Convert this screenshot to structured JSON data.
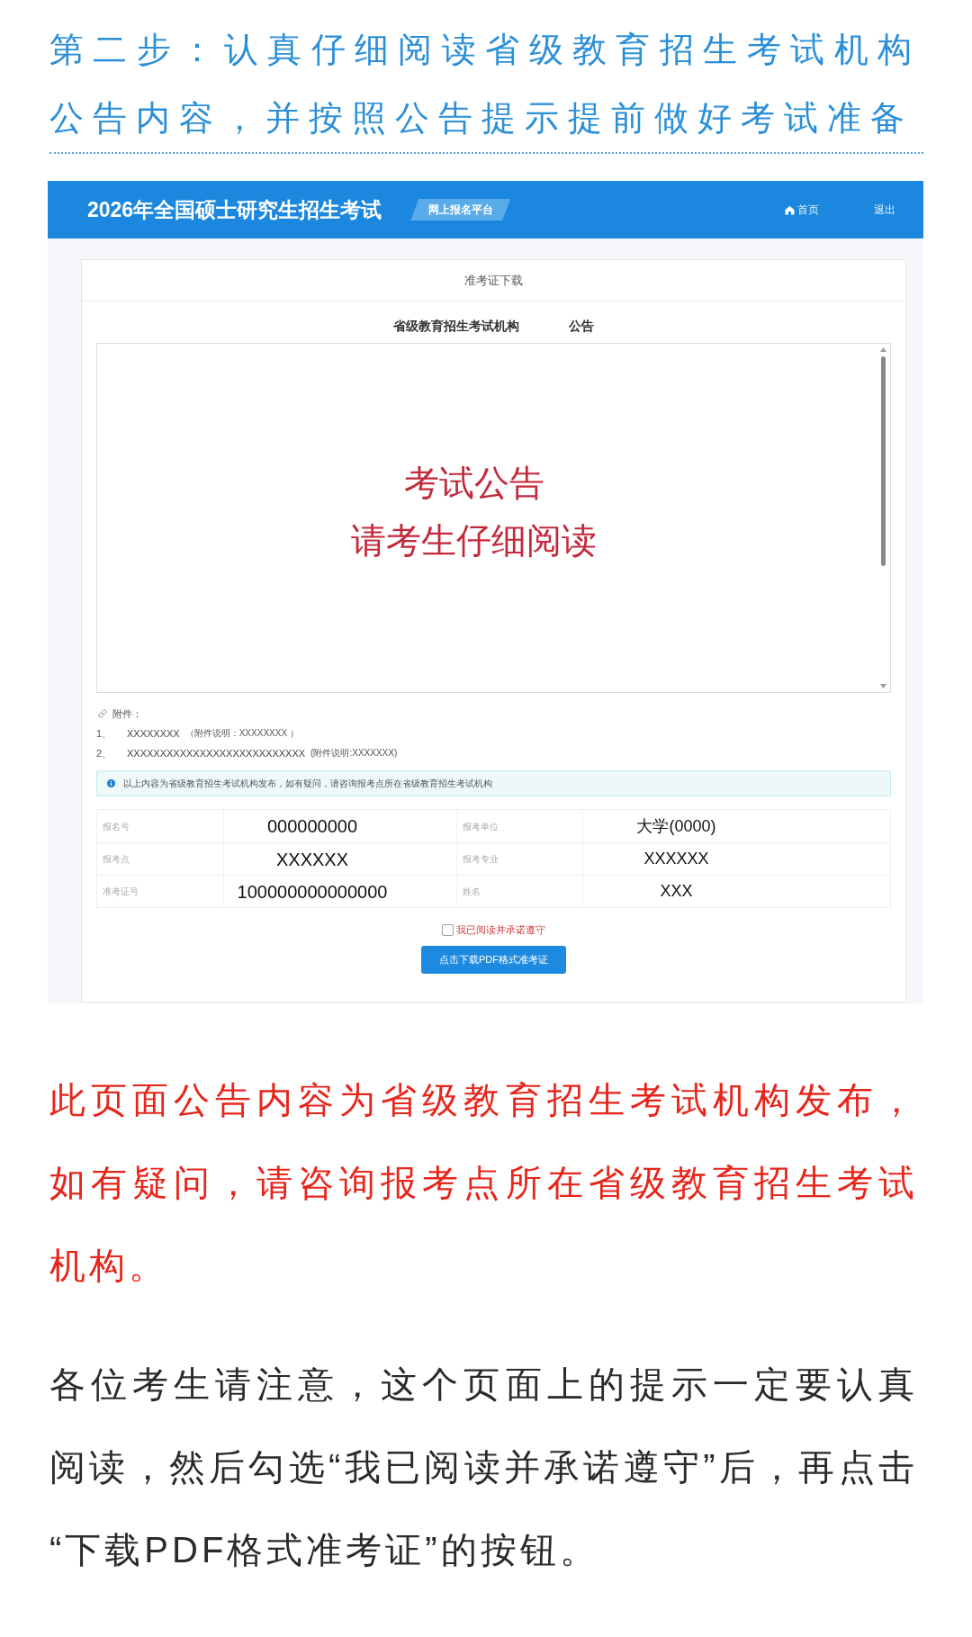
{
  "heading": "第二步：认真仔细阅读省级教育招生考试机构公告内容，并按照公告提示提前做好考试准备",
  "screenshot": {
    "header": {
      "title": "2026年全国硕士研究生招生考试",
      "badge": "网上报名平台",
      "nav": [
        {
          "kind": "home",
          "label": "首页"
        },
        {
          "kind": "plain",
          "label": "退出"
        }
      ]
    },
    "card": {
      "title": "准考证下载",
      "notice": {
        "issuer": "省级教育招生考试机构",
        "label": "公告",
        "body": [
          "考试公告",
          "请考生仔细阅读"
        ]
      },
      "attachments": {
        "label": "附件：",
        "items": [
          {
            "index": "1、",
            "name": "XXXXXXXX",
            "note": "（附件说明：XXXXXXXX ）"
          },
          {
            "index": "2、",
            "name": "XXXXXXXXXXXXXXXXXXXXXXXXXXX",
            "note": "(附件说明:XXXXXXX)"
          }
        ]
      },
      "alert": "以上内容为省级教育招生考试机构发布，如有疑问，请咨询报考点所在省级教育招生考试机构",
      "info_table": {
        "rows": [
          {
            "fields": [
              {
                "label": "报名号",
                "value": "000000000"
              },
              {
                "label": "报考单位",
                "value": "大学(0000)"
              }
            ]
          },
          {
            "fields": [
              {
                "label": "报考点",
                "value": "XXXXXX"
              },
              {
                "label": "报考专业",
                "value": "XXXXXX"
              }
            ]
          },
          {
            "fields": [
              {
                "label": "准考证号",
                "value": "100000000000000"
              },
              {
                "label": "姓名",
                "value": "XXX"
              }
            ]
          }
        ]
      },
      "agreement": {
        "label": "我已阅读并承诺遵守",
        "checked": false
      },
      "download_button": "点击下载PDF格式准考证"
    }
  },
  "warning": "此页面公告内容为省级教育招生考试机构发布，如有疑问，请咨询报考点所在省级教育招生考试机构。",
  "instructions": "各位考生请注意，这个页面上的提示一定要认真阅读，然后勾选“我已阅读并承诺遵守”后，再点击“下载PDF格式准考证”的按钮。"
}
